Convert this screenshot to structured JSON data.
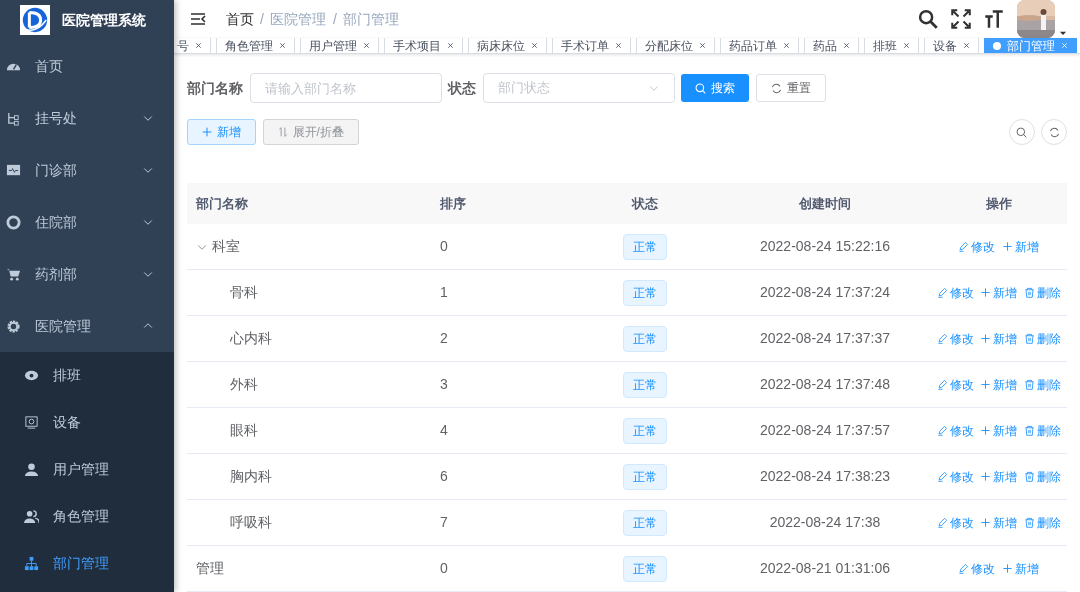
{
  "app": {
    "title": "医院管理系统"
  },
  "sidebar": {
    "items": [
      {
        "label": "首页",
        "selected": false
      },
      {
        "label": "挂号处",
        "expanded": false,
        "selected": false
      },
      {
        "label": "门诊部",
        "expanded": false,
        "selected": false
      },
      {
        "label": "住院部",
        "expanded": false,
        "selected": false
      },
      {
        "label": "药剂部",
        "expanded": false,
        "selected": false
      },
      {
        "label": "医院管理",
        "expanded": true,
        "selected": false,
        "children": [
          {
            "label": "排班",
            "selected": false
          },
          {
            "label": "设备",
            "selected": false
          },
          {
            "label": "用户管理",
            "selected": false
          },
          {
            "label": "角色管理",
            "selected": false
          },
          {
            "label": "部门管理",
            "selected": true
          }
        ]
      }
    ]
  },
  "breadcrumb": {
    "separator": "/",
    "items": [
      "首页",
      "医院管理",
      "部门管理"
    ]
  },
  "tags": [
    {
      "label": "号",
      "selected": false
    },
    {
      "label": "角色管理",
      "selected": false
    },
    {
      "label": "用户管理",
      "selected": false
    },
    {
      "label": "手术项目",
      "selected": false
    },
    {
      "label": "病床床位",
      "selected": false
    },
    {
      "label": "手术订单",
      "selected": false
    },
    {
      "label": "分配床位",
      "selected": false
    },
    {
      "label": "药品订单",
      "selected": false
    },
    {
      "label": "药品",
      "selected": false
    },
    {
      "label": "排班",
      "selected": false
    },
    {
      "label": "设备",
      "selected": false
    },
    {
      "label": "部门管理",
      "selected": true
    }
  ],
  "filters": {
    "name_label": "部门名称",
    "name_placeholder": "请输入部门名称",
    "status_label": "状态",
    "status_placeholder": "部门状态",
    "search": "搜索",
    "reset": "重置"
  },
  "toolbar": {
    "add": "新增",
    "toggle": "展开/折叠"
  },
  "table": {
    "columns": [
      "部门名称",
      "排序",
      "状态",
      "创建时间",
      "操作"
    ],
    "rows": [
      {
        "name": "科室",
        "order": "0",
        "status": "正常",
        "created": "2022-08-24 15:22:16",
        "expanded": true,
        "actions": [
          {
            "kind": "edit",
            "label": "修改"
          },
          {
            "kind": "add",
            "label": "新增"
          }
        ],
        "children": [
          {
            "name": "骨科",
            "order": "1",
            "status": "正常",
            "created": "2022-08-24 17:37:24",
            "actions": [
              {
                "kind": "edit",
                "label": "修改"
              },
              {
                "kind": "add",
                "label": "新增"
              },
              {
                "kind": "delete",
                "label": "删除"
              }
            ]
          },
          {
            "name": "心内科",
            "order": "2",
            "status": "正常",
            "created": "2022-08-24 17:37:37",
            "actions": [
              {
                "kind": "edit",
                "label": "修改"
              },
              {
                "kind": "add",
                "label": "新增"
              },
              {
                "kind": "delete",
                "label": "删除"
              }
            ]
          },
          {
            "name": "外科",
            "order": "3",
            "status": "正常",
            "created": "2022-08-24 17:37:48",
            "actions": [
              {
                "kind": "edit",
                "label": "修改"
              },
              {
                "kind": "add",
                "label": "新增"
              },
              {
                "kind": "delete",
                "label": "删除"
              }
            ]
          },
          {
            "name": "眼科",
            "order": "4",
            "status": "正常",
            "created": "2022-08-24 17:37:57",
            "actions": [
              {
                "kind": "edit",
                "label": "修改"
              },
              {
                "kind": "add",
                "label": "新增"
              },
              {
                "kind": "delete",
                "label": "删除"
              }
            ]
          },
          {
            "name": "胸内科",
            "order": "6",
            "status": "正常",
            "created": "2022-08-24 17:38:23",
            "actions": [
              {
                "kind": "edit",
                "label": "修改"
              },
              {
                "kind": "add",
                "label": "新增"
              },
              {
                "kind": "delete",
                "label": "删除"
              }
            ]
          },
          {
            "name": "呼吸科",
            "order": "7",
            "status": "正常",
            "created": "2022-08-24 17:38",
            "actions": [
              {
                "kind": "edit",
                "label": "修改"
              },
              {
                "kind": "add",
                "label": "新增"
              },
              {
                "kind": "delete",
                "label": "删除"
              }
            ]
          }
        ]
      },
      {
        "name": "管理",
        "order": "0",
        "status": "正常",
        "created": "2022-08-21 01:31:06",
        "actions": [
          {
            "kind": "edit",
            "label": "修改"
          },
          {
            "kind": "add",
            "label": "新增"
          }
        ]
      }
    ]
  }
}
